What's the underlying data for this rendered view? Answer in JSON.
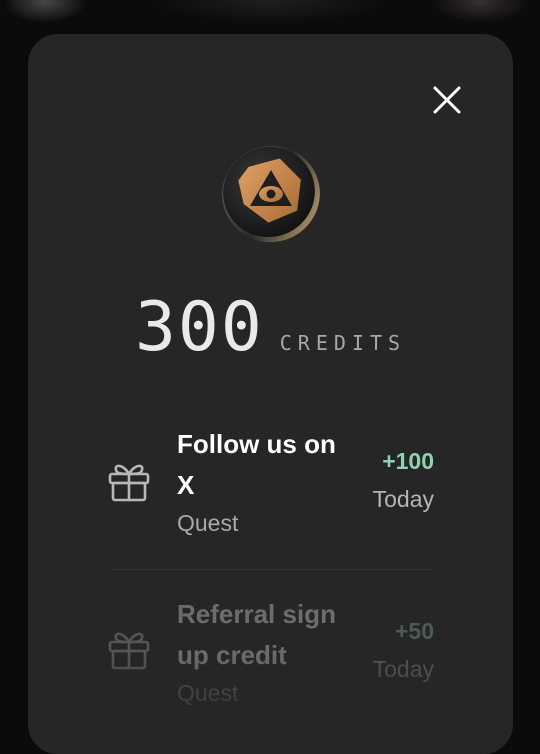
{
  "modal": {
    "close_icon": "close-icon"
  },
  "balance": {
    "coin_icon": "coin-icon",
    "amount": "300",
    "unit": "CREDITS"
  },
  "history": [
    {
      "icon": "gift-icon",
      "title": "Follow us on X",
      "type": "Quest",
      "points": "+100",
      "when": "Today"
    },
    {
      "icon": "gift-icon",
      "title": "Referral sign up credit",
      "type": "Quest",
      "points": "+50",
      "when": "Today"
    }
  ],
  "colors": {
    "modal_bg": "#262626",
    "points_accent": "#8fd1b0",
    "coin_gold": "#c98a4e"
  }
}
